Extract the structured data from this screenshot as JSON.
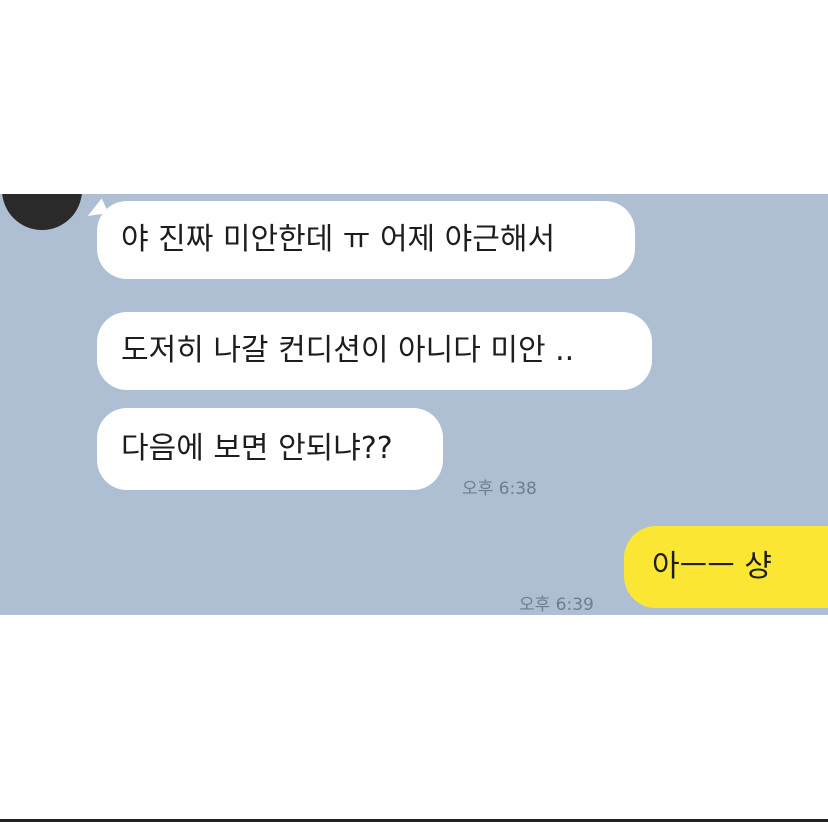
{
  "chat": {
    "messages": [
      {
        "sender": "other",
        "text": "야 진짜 미안한데 ㅠ 어제 야근해서"
      },
      {
        "sender": "other",
        "text": "도저히 나갈 컨디션이 아니다 미안 .."
      },
      {
        "sender": "other",
        "text": "다음에 보면 안되냐??"
      },
      {
        "sender": "me",
        "text": "아ㅡㅡ 샹"
      }
    ],
    "timestamps": {
      "other": "오후 6:38",
      "me": "오후 6:39"
    }
  },
  "colors": {
    "chat_background": "#aebfd3",
    "incoming_bubble": "#ffffff",
    "outgoing_bubble": "#fbe733",
    "timestamp_text": "#6f7d8c"
  }
}
